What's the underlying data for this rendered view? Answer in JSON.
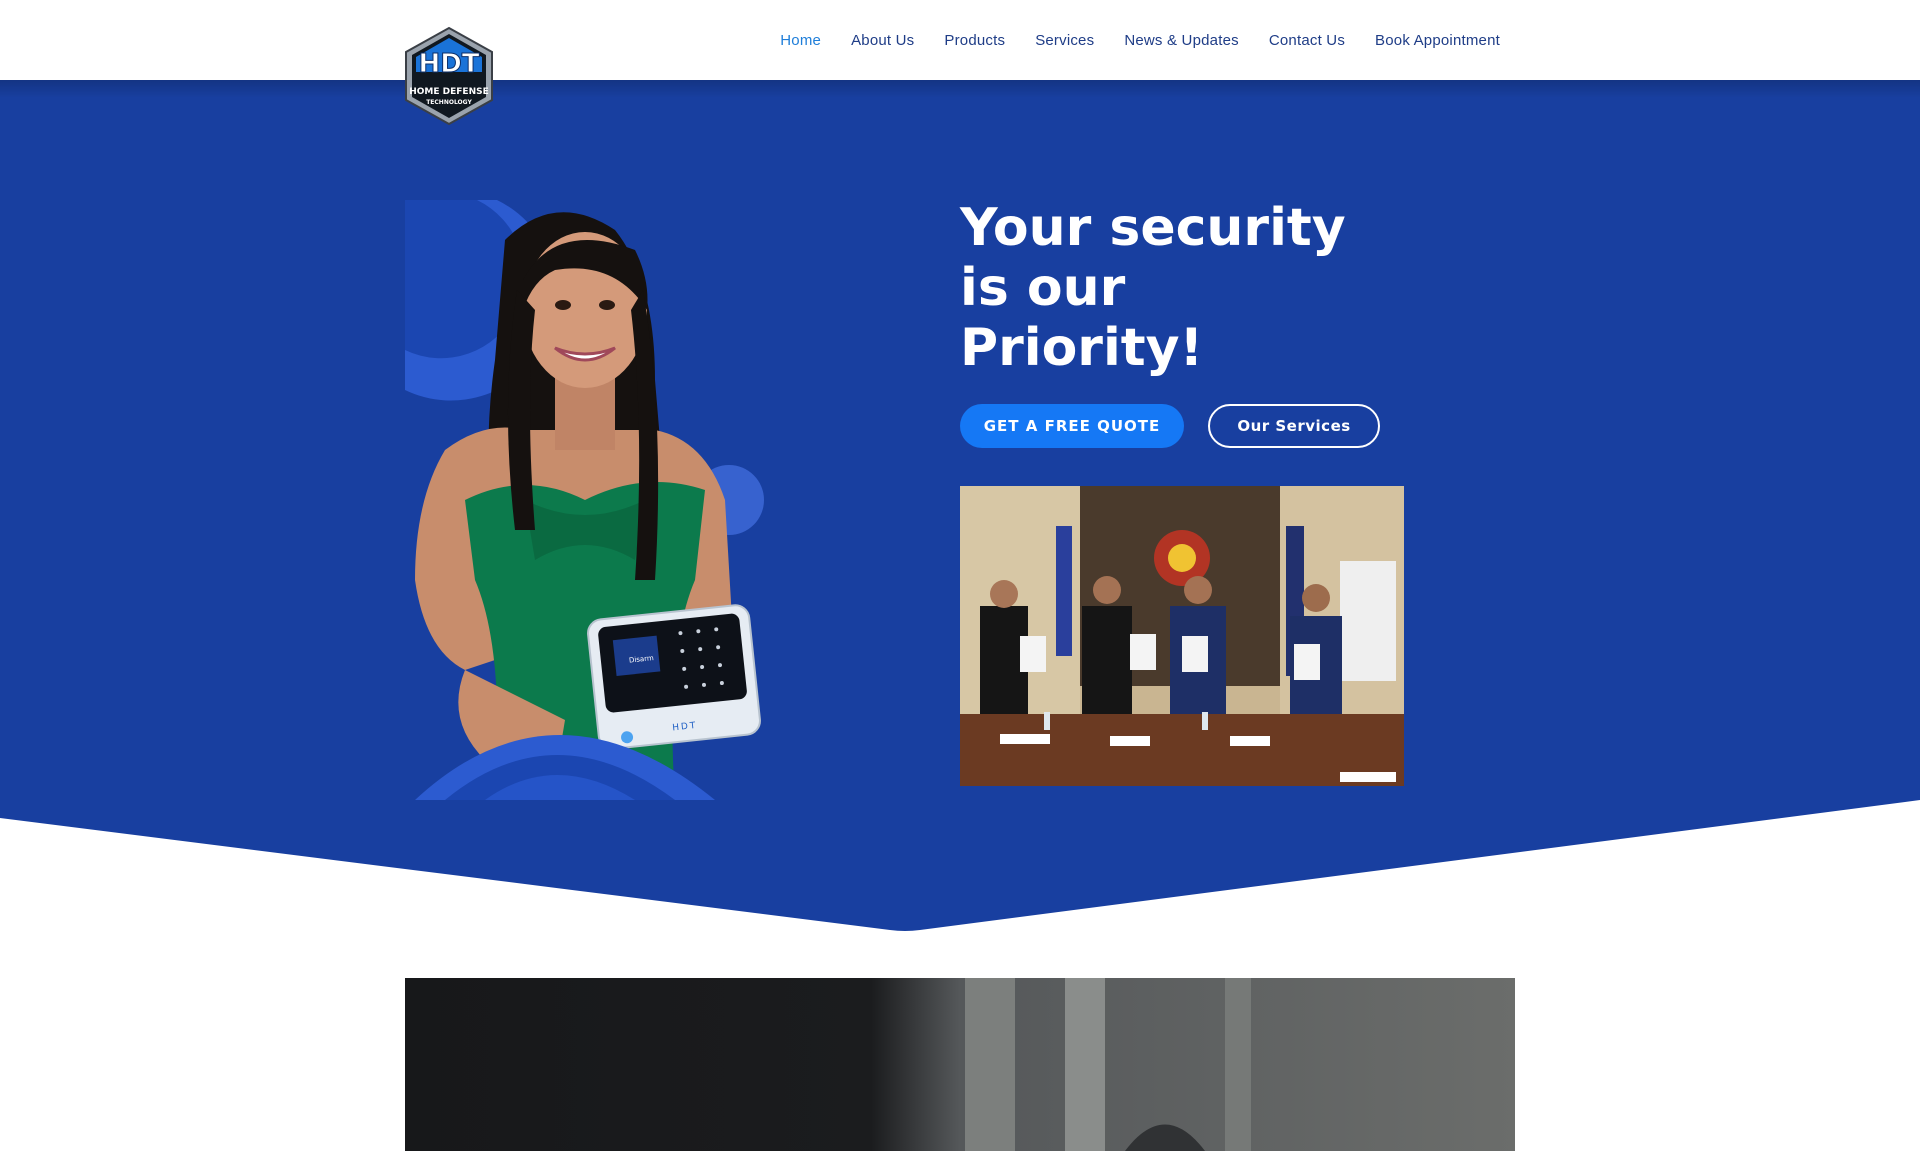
{
  "nav": {
    "items": [
      {
        "label": "Home",
        "active": true
      },
      {
        "label": "About Us"
      },
      {
        "label": "Products"
      },
      {
        "label": "Services"
      },
      {
        "label": "News & Updates"
      },
      {
        "label": "Contact Us"
      },
      {
        "label": "Book Appointment"
      }
    ]
  },
  "logo": {
    "mark": "HDT",
    "line1": "HOME DEFENSE",
    "line2": "TECHNOLOGY"
  },
  "hero": {
    "headline_line1": "Your security",
    "headline_line2": "is our",
    "headline_line3": "Priority!",
    "cta_primary": "GET A FREE QUOTE",
    "cta_secondary": "Our Services",
    "device_brand": "HDT",
    "device_screen_text": "Disarm"
  },
  "colors": {
    "hero_blue": "#183fa0",
    "accent_blue": "#1578f5",
    "nav_text": "#1f3d87",
    "nav_active": "#1f7ed9"
  }
}
